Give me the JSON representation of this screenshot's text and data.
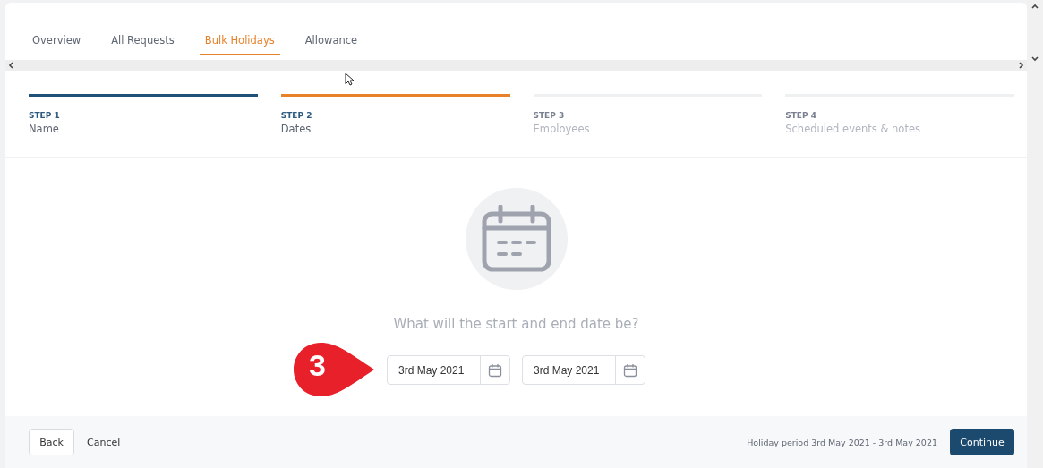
{
  "tabs": [
    {
      "label": "Overview",
      "selected": false
    },
    {
      "label": "All Requests",
      "selected": false
    },
    {
      "label": "Bulk Holidays",
      "selected": true
    },
    {
      "label": "Allowance",
      "selected": false
    }
  ],
  "steps": [
    {
      "label": "STEP 1",
      "name": "Name",
      "completed": true,
      "selected": false
    },
    {
      "label": "STEP 2",
      "name": "Dates",
      "completed": false,
      "selected": true
    },
    {
      "label": "STEP 3",
      "name": "Employees",
      "completed": false,
      "selected": false
    },
    {
      "label": "STEP 4",
      "name": "Scheduled events & notes",
      "completed": false,
      "selected": false
    }
  ],
  "question": "What will the start and end date be?",
  "callout": "3",
  "date_fields": [
    {
      "value": "3rd May 2021"
    },
    {
      "value": "3rd May 2021"
    }
  ],
  "footer": {
    "back": "Back",
    "cancel": "Cancel",
    "summary": "Holiday period 3rd May 2021 - 3rd May 2021",
    "continue": "Continue"
  }
}
